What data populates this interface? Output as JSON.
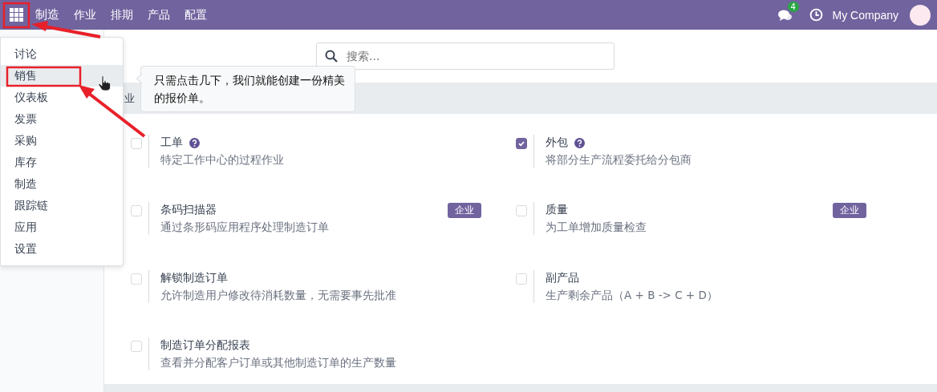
{
  "navbar": {
    "app_name": "制造",
    "menu": [
      "作业",
      "排期",
      "产品",
      "配置"
    ],
    "notification_count": "4",
    "company": "My Company"
  },
  "app_menu": [
    {
      "label": "讨论",
      "selected": false
    },
    {
      "label": "销售",
      "selected": true
    },
    {
      "label": "仪表板",
      "selected": false
    },
    {
      "label": "发票",
      "selected": false
    },
    {
      "label": "采购",
      "selected": false
    },
    {
      "label": "库存",
      "selected": false
    },
    {
      "label": "制造",
      "selected": false
    },
    {
      "label": "跟踪链",
      "selected": false
    },
    {
      "label": "应用",
      "selected": false
    },
    {
      "label": "设置",
      "selected": false
    }
  ],
  "tooltip": "只需点击几下，我们就能创建一份精美的报价单。",
  "search": {
    "placeholder": "搜索..."
  },
  "section_title": "业",
  "settings": [
    {
      "title": "工单",
      "help": true,
      "description": "特定工作中心的过程作业",
      "checked": false
    },
    {
      "title": "外包",
      "help": true,
      "description": "将部分生产流程委托给分包商",
      "checked": true
    },
    {
      "title": "条码扫描器",
      "badge": "企业",
      "description": "通过条形码应用程序处理制造订单",
      "checked": false
    },
    {
      "title": "质量",
      "badge": "企业",
      "description": "为工单增加质量检查",
      "checked": false
    },
    {
      "title": "解锁制造订单",
      "description": "允许制造用户修改待消耗数量，无需要事先批准",
      "checked": false
    },
    {
      "title": "副产品",
      "description": "生产剩余产品（A + B -> C + D）",
      "checked": false
    },
    {
      "title": "制造订单分配报表",
      "description": "查看并分配客户订单或其他制造订单的生产数量",
      "checked": false
    }
  ]
}
